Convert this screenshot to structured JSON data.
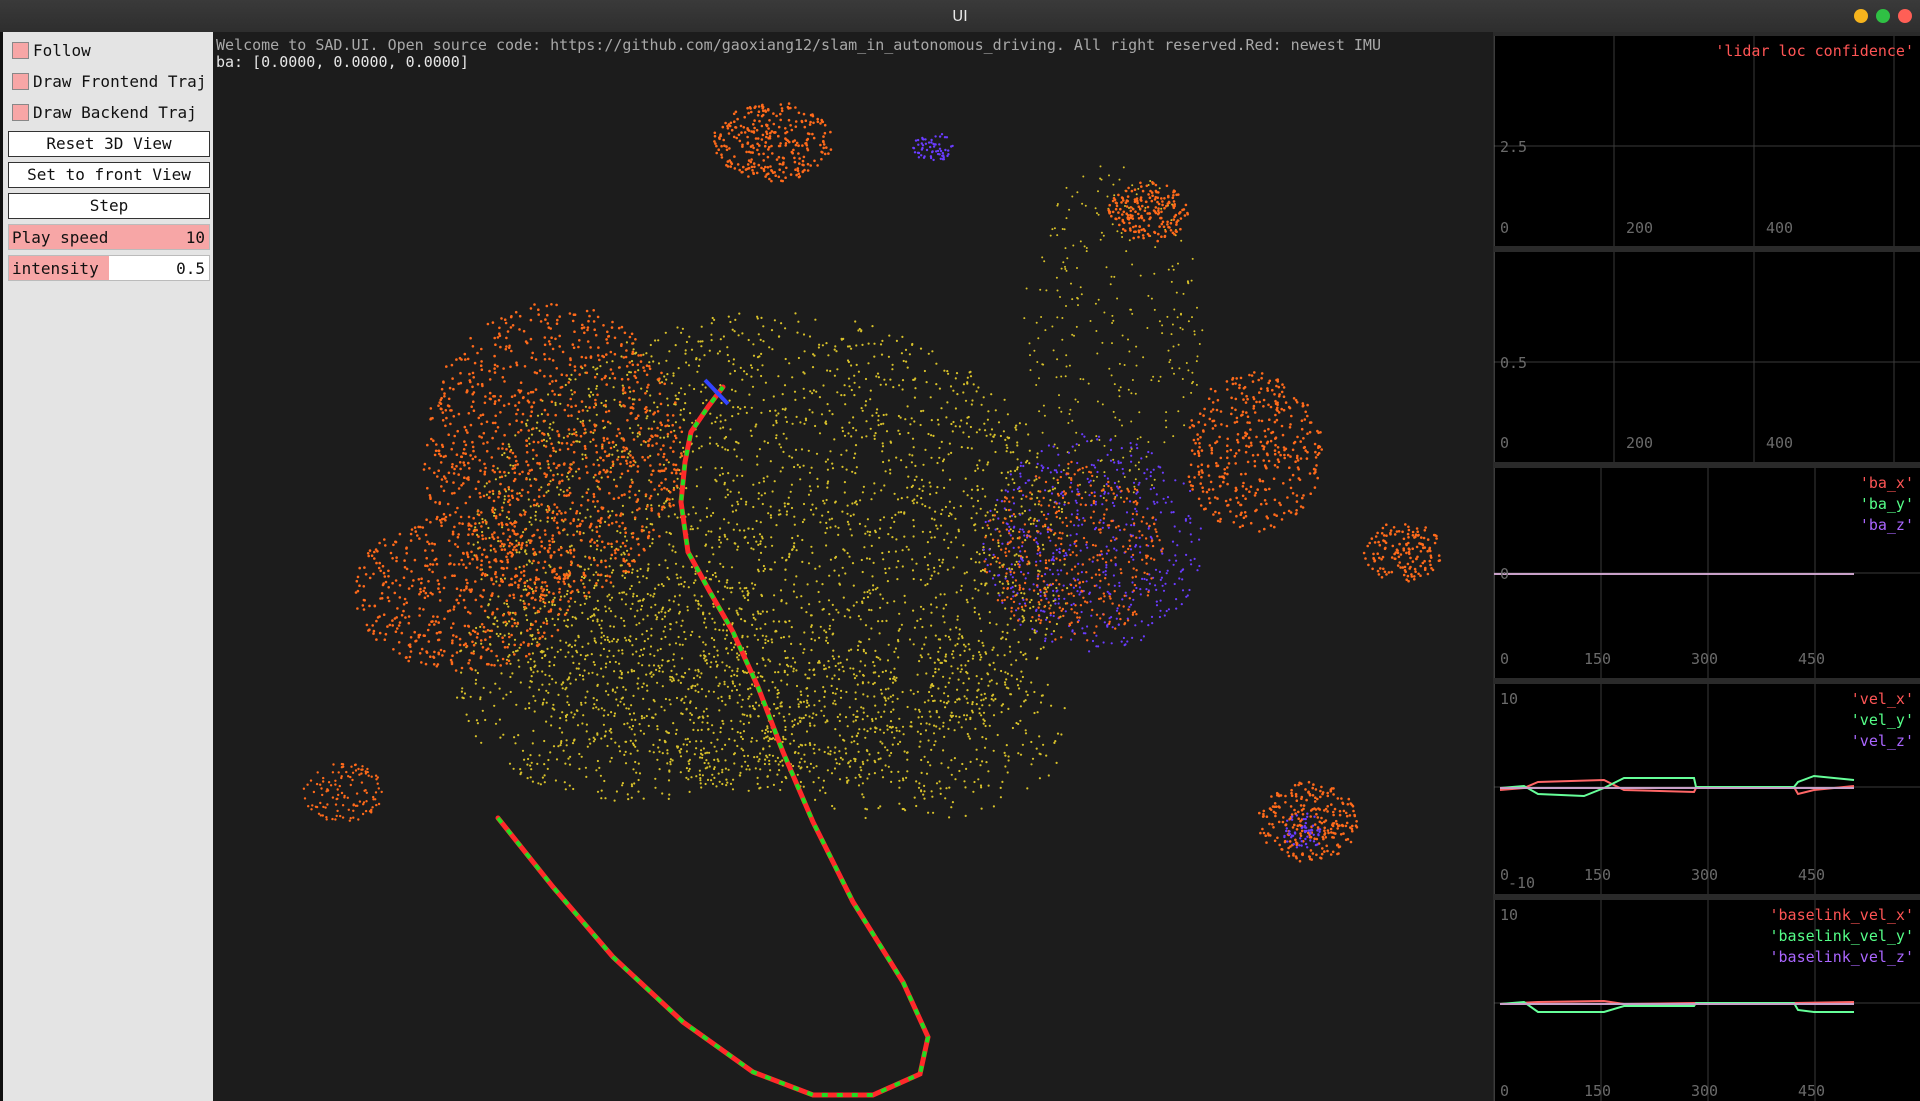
{
  "window": {
    "title": "UI"
  },
  "panel": {
    "follow_label": "Follow",
    "frontend_label": "Draw Frontend Traj",
    "backend_label": "Draw Backend Traj",
    "reset_label": "Reset 3D View",
    "front_label": "Set to front View",
    "step_label": "Step",
    "play_speed": {
      "label": "Play speed",
      "value": "10",
      "fraction": 1.0
    },
    "intensity": {
      "label": "intensity",
      "value": "0.5",
      "fraction": 0.5
    }
  },
  "viewer": {
    "welcome": "Welcome to SAD.UI. Open source code: https://github.com/gaoxiang12/slam_in_autonomous_driving. All right reserved.Red: newest IMU",
    "ba_readout": "ba: [0.0000, 0.0000, 0.0000]"
  },
  "plots": [
    {
      "id": "lidar",
      "legend": [
        {
          "text": "'lidar loc confidence'",
          "color": "#ff5555"
        }
      ],
      "yticks": [
        "2.5"
      ],
      "xticks": [
        "0",
        "200",
        "400"
      ]
    },
    {
      "id": "p2",
      "legend": [],
      "yticks": [
        "0.5"
      ],
      "xticks": [
        "0",
        "200",
        "400"
      ]
    },
    {
      "id": "ba",
      "legend": [
        {
          "text": "'ba_x'",
          "color": "#ff5555"
        },
        {
          "text": "'ba_y'",
          "color": "#55ff88"
        },
        {
          "text": "'ba_z'",
          "color": "#aa66ff"
        }
      ],
      "yticks": [
        "0"
      ],
      "xticks": [
        "0",
        "150",
        "300",
        "450"
      ]
    },
    {
      "id": "vel",
      "legend": [
        {
          "text": "'vel_x'",
          "color": "#ff5555"
        },
        {
          "text": "'vel_y'",
          "color": "#55ff88"
        },
        {
          "text": "'vel_z'",
          "color": "#aa66ff"
        }
      ],
      "yticks": [
        "10",
        "-10"
      ],
      "xticks": [
        "0",
        "150",
        "300",
        "450"
      ]
    },
    {
      "id": "baselink",
      "legend": [
        {
          "text": "'baselink_vel_x'",
          "color": "#ff5555"
        },
        {
          "text": "'baselink_vel_y'",
          "color": "#55ff88"
        },
        {
          "text": "'baselink_vel_z'",
          "color": "#aa66ff"
        }
      ],
      "yticks": [
        "10"
      ],
      "xticks": [
        "0",
        "150",
        "300",
        "450"
      ]
    }
  ],
  "colors": {
    "trajectory_red": "#ff2a2a",
    "trajectory_green": "#22dd22",
    "ground_points": "#d8c12a",
    "building_points": "#ff6a1a",
    "tree_points": "#6a3cff"
  }
}
